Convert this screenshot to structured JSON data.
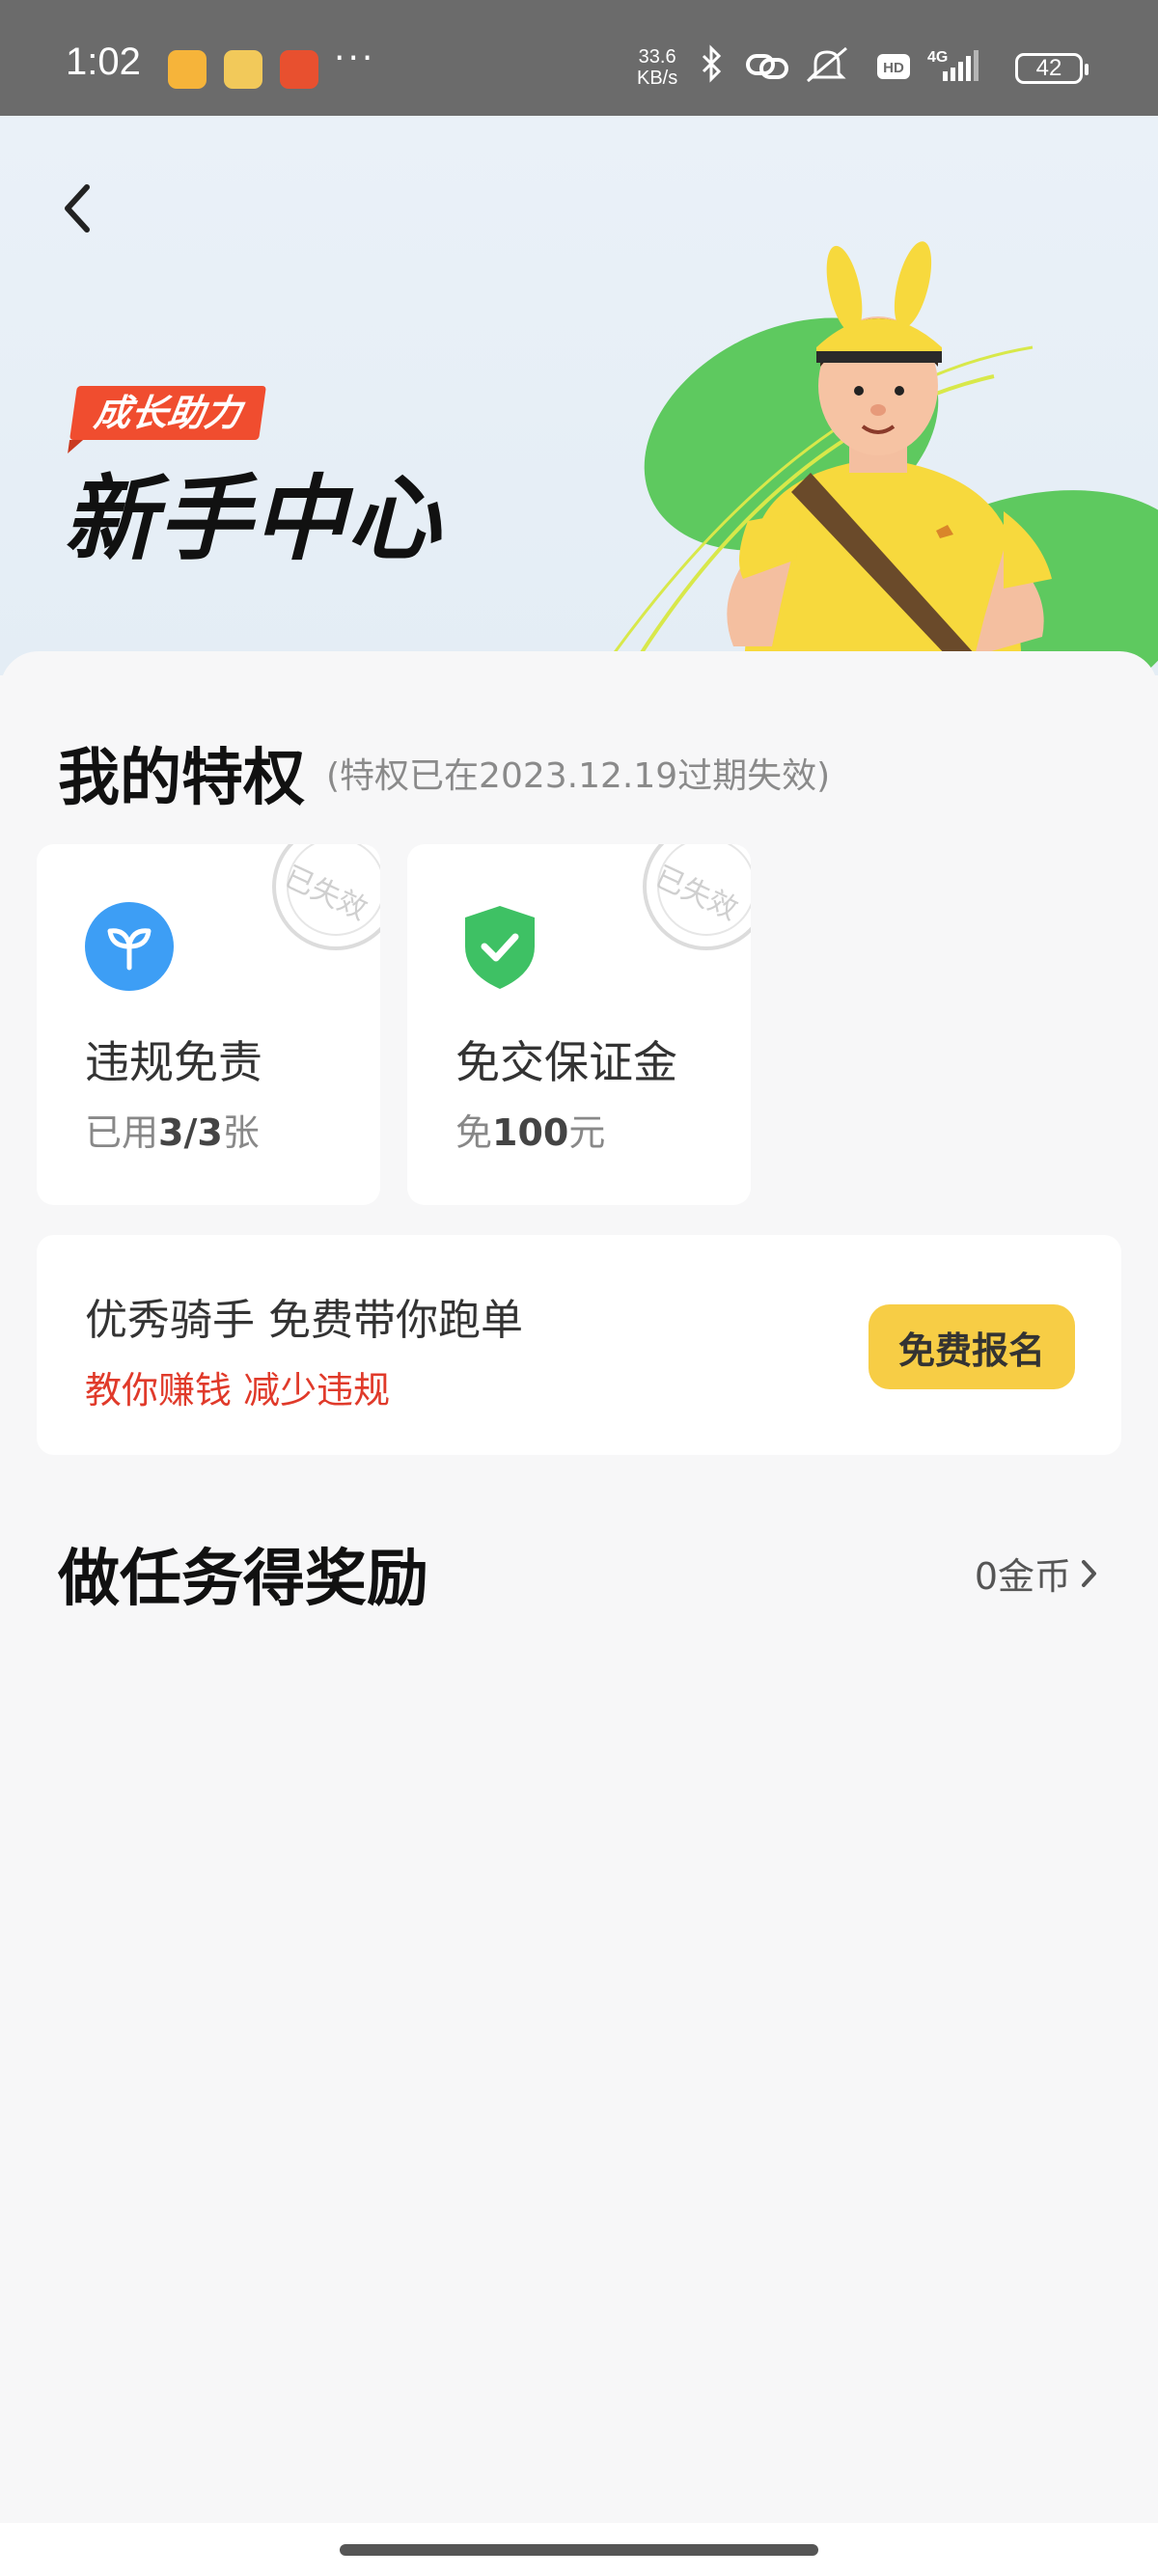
{
  "status_bar": {
    "time": "1:02",
    "dots": "···",
    "net_speed_value": "33.6",
    "net_speed_unit": "KB/s",
    "network": "4G",
    "battery": "42"
  },
  "header": {
    "tag": "成长助力",
    "title": "新手中心"
  },
  "privileges": {
    "title": "我的特权",
    "note": "(特权已在2023.12.19过期失效)",
    "stamp_label": "已失效",
    "cards": [
      {
        "name": "违规免责",
        "sub_prefix": "已用",
        "sub_value": "3/3",
        "sub_suffix": "张",
        "icon": "sprout-icon",
        "color": "#3d9ef5"
      },
      {
        "name": "免交保证金",
        "sub_prefix": "免",
        "sub_value": "100",
        "sub_suffix": "元",
        "icon": "shield-check-icon",
        "color": "#3ec164"
      }
    ]
  },
  "promo": {
    "title": "优秀骑手 免费带你跑单",
    "subtitle": "教你赚钱 减少违规",
    "button": "免费报名"
  },
  "tasks": {
    "title": "做任务得奖励",
    "coins": "0金币"
  },
  "colors": {
    "accent_yellow": "#f7cd45",
    "alert_red": "#e03a2a",
    "tag_red": "#f04d2f"
  }
}
